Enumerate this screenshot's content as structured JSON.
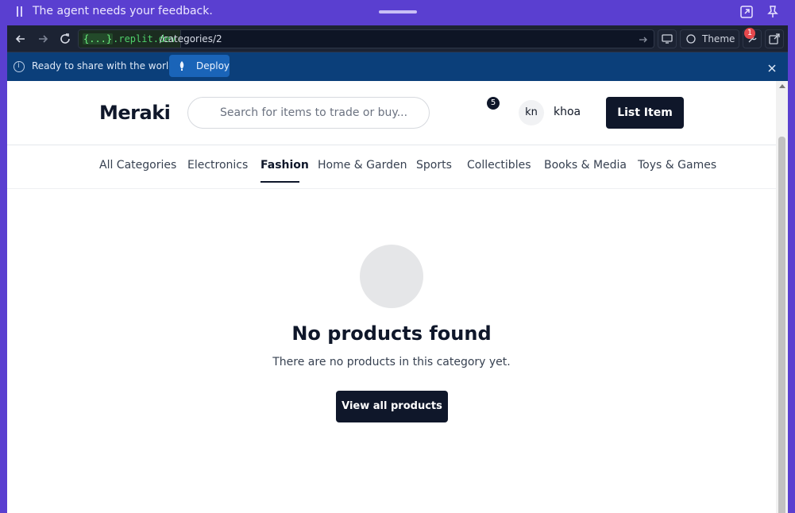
{
  "agent_bar": {
    "message": "The agent needs your feedback."
  },
  "browser": {
    "url_host_brace": "{...}",
    "url_host_suffix": ".replit.dev",
    "url_path": "/categories/2",
    "theme_label": "Theme",
    "notifications_count": "1"
  },
  "banner": {
    "text": "Ready to share with the world?",
    "deploy_label": "Deploy"
  },
  "header": {
    "logo": "Meraki",
    "search_placeholder": "Search for items to trade or buy...",
    "cart_count": "5",
    "avatar_initials": "kn",
    "username": "khoa",
    "list_item_label": "List Item"
  },
  "categories": {
    "items": [
      {
        "label": "All Categories"
      },
      {
        "label": "Electronics"
      },
      {
        "label": "Fashion"
      },
      {
        "label": "Home & Garden"
      },
      {
        "label": "Sports"
      },
      {
        "label": "Collectibles"
      },
      {
        "label": "Books & Media"
      },
      {
        "label": "Toys & Games"
      }
    ],
    "active": "Fashion"
  },
  "empty_state": {
    "title": "No products found",
    "subtitle": "There are no products in this category yet.",
    "button_label": "View all products"
  },
  "colors": {
    "agent_bar": "#5a3fd0",
    "chrome_bg": "#1c2333",
    "banner_bg": "#0b3f7a",
    "primary_dark": "#0f172a",
    "url_host_green": "#4fd06a"
  }
}
